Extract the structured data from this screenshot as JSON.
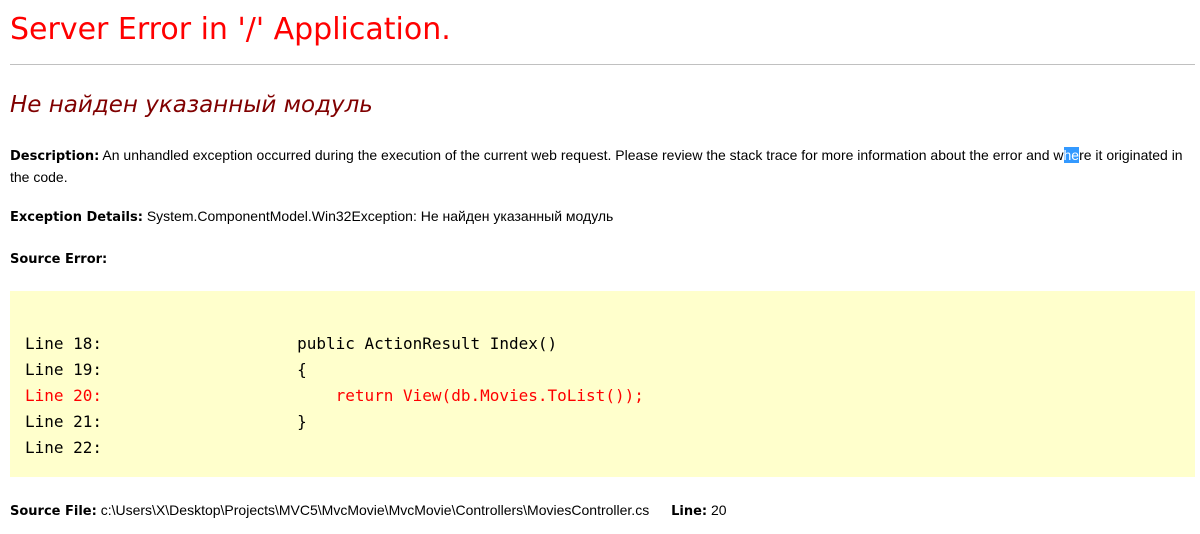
{
  "page": {
    "title": "Server Error in '/' Application.",
    "error_heading": "Не найден указанный модуль"
  },
  "description": {
    "label": "Description:",
    "text_before_selection": "An unhandled exception occurred during the execution of the current web request. Please review the stack trace for more information about the error and w",
    "selected_text": "he",
    "text_after_selection": "re it originated in the code."
  },
  "exception": {
    "label": "Exception Details:",
    "text": "System.ComponentModel.Win32Exception: Не найден указанный модуль"
  },
  "source_error": {
    "label": "Source Error:",
    "lines": [
      {
        "number": "Line 18:",
        "code": "        public ActionResult Index()",
        "highlight": false
      },
      {
        "number": "Line 19:",
        "code": "        {",
        "highlight": false
      },
      {
        "number": "Line 20:",
        "code": "            return View(db.Movies.ToList());",
        "highlight": true
      },
      {
        "number": "Line 21:",
        "code": "        }",
        "highlight": false
      },
      {
        "number": "Line 22:",
        "code": "",
        "highlight": false
      }
    ]
  },
  "source_file": {
    "label": "Source File:",
    "path": "c:\\Users\\X\\Desktop\\Projects\\MVC5\\MvcMovie\\MvcMovie\\Controllers\\MoviesController.cs",
    "line_label": "Line:",
    "line_value": "20"
  },
  "colors": {
    "title": "#ff0000",
    "error_heading": "#800000",
    "source_box_background": "#ffffcc",
    "highlighted_code": "#ff0000",
    "selection": "#3399ff"
  }
}
